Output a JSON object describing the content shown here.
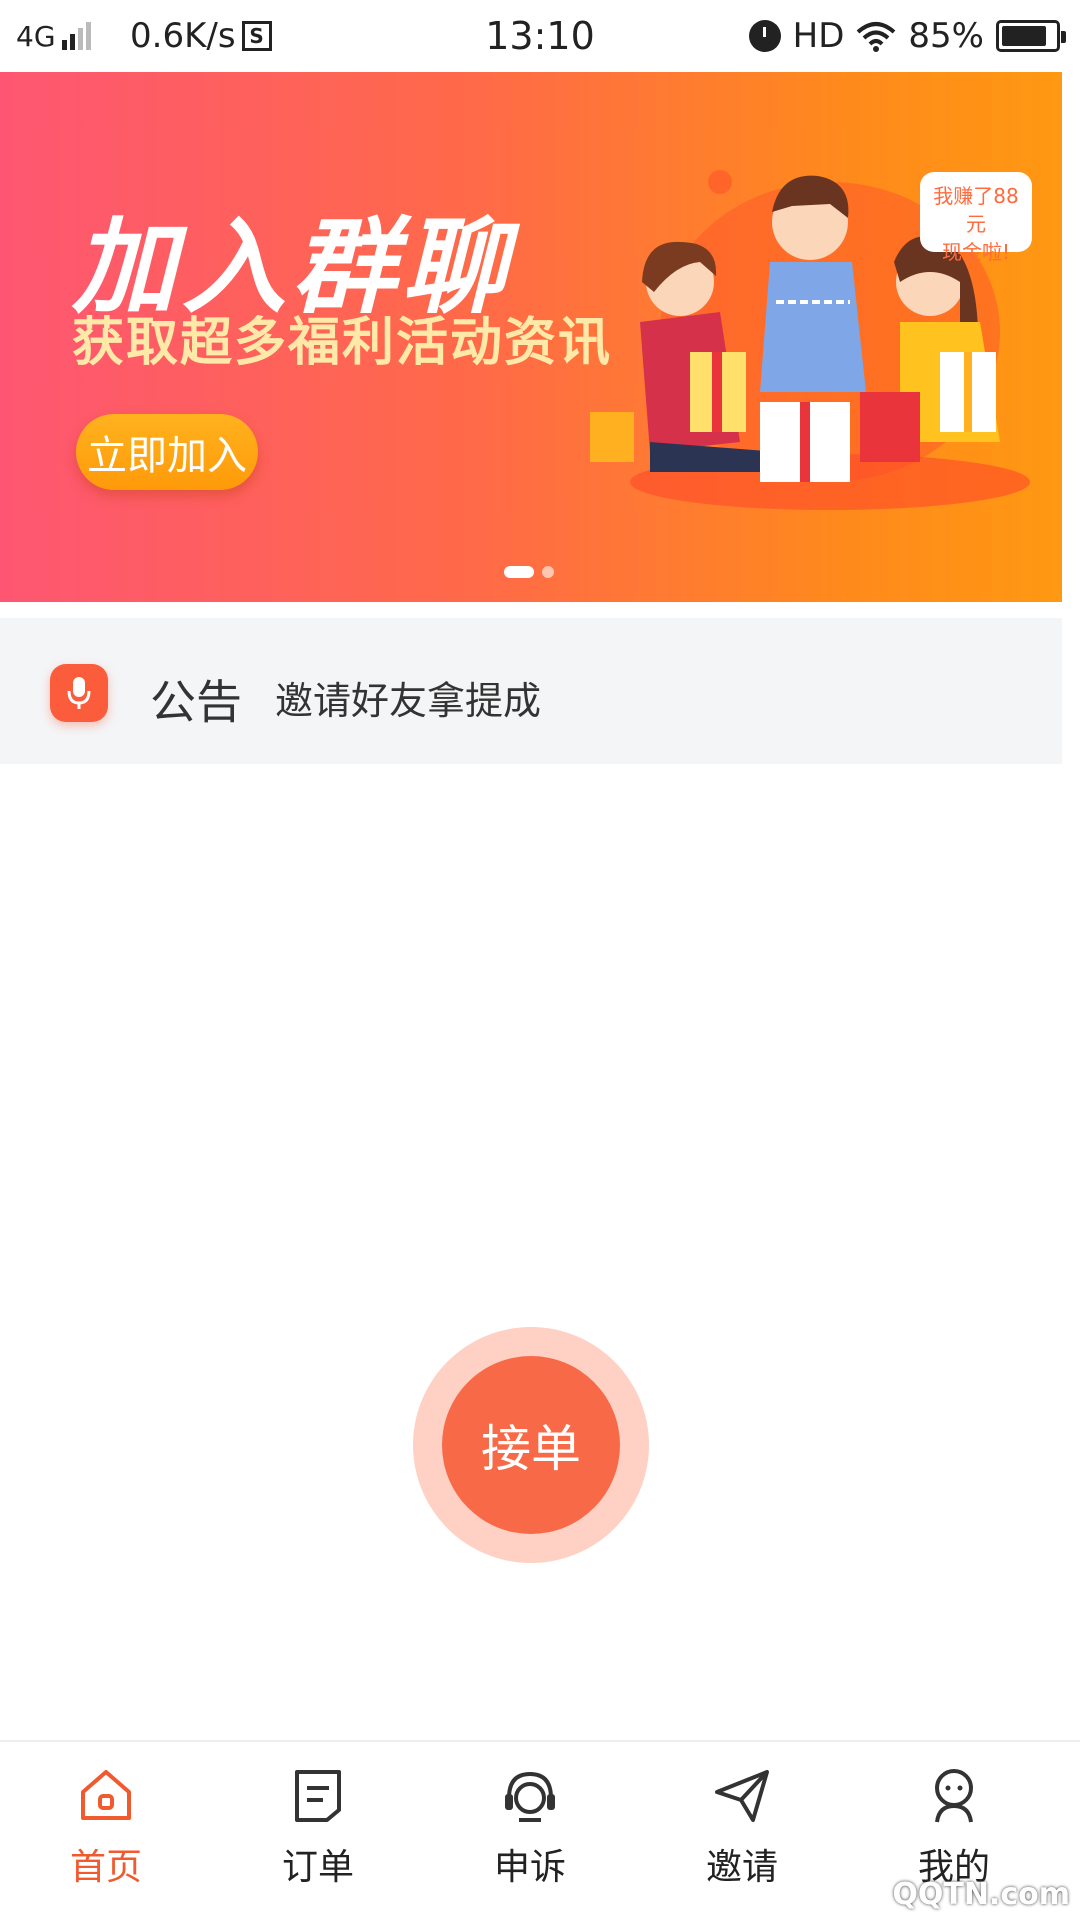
{
  "status_bar": {
    "network": "4G",
    "speed": "0.6K/s",
    "s_icon_label": "S",
    "time": "13:10",
    "hd": "HD",
    "battery": "85%"
  },
  "banner": {
    "title": "加入群聊",
    "subtitle": "获取超多福利活动资讯",
    "button": "立即加入",
    "speech_bubble_line1": "我赚了88元",
    "speech_bubble_line2": "现金啦!",
    "slide_count": 2,
    "active_slide": 1
  },
  "notice": {
    "label": "公告",
    "text": "邀请好友拿提成"
  },
  "main": {
    "accept_button": "接单"
  },
  "bottom_nav": {
    "items": [
      {
        "label": "首页",
        "icon": "home-icon",
        "active": true
      },
      {
        "label": "订单",
        "icon": "order-icon",
        "active": false
      },
      {
        "label": "申诉",
        "icon": "headset-icon",
        "active": false
      },
      {
        "label": "邀请",
        "icon": "send-icon",
        "active": false
      },
      {
        "label": "我的",
        "icon": "profile-icon",
        "active": false
      }
    ]
  },
  "watermark": "QQTN.com",
  "colors": {
    "accent": "#f05a2e",
    "button": "#f86a47",
    "button_ring": "#ffd0c4",
    "notice_bg": "#f4f5f7"
  }
}
